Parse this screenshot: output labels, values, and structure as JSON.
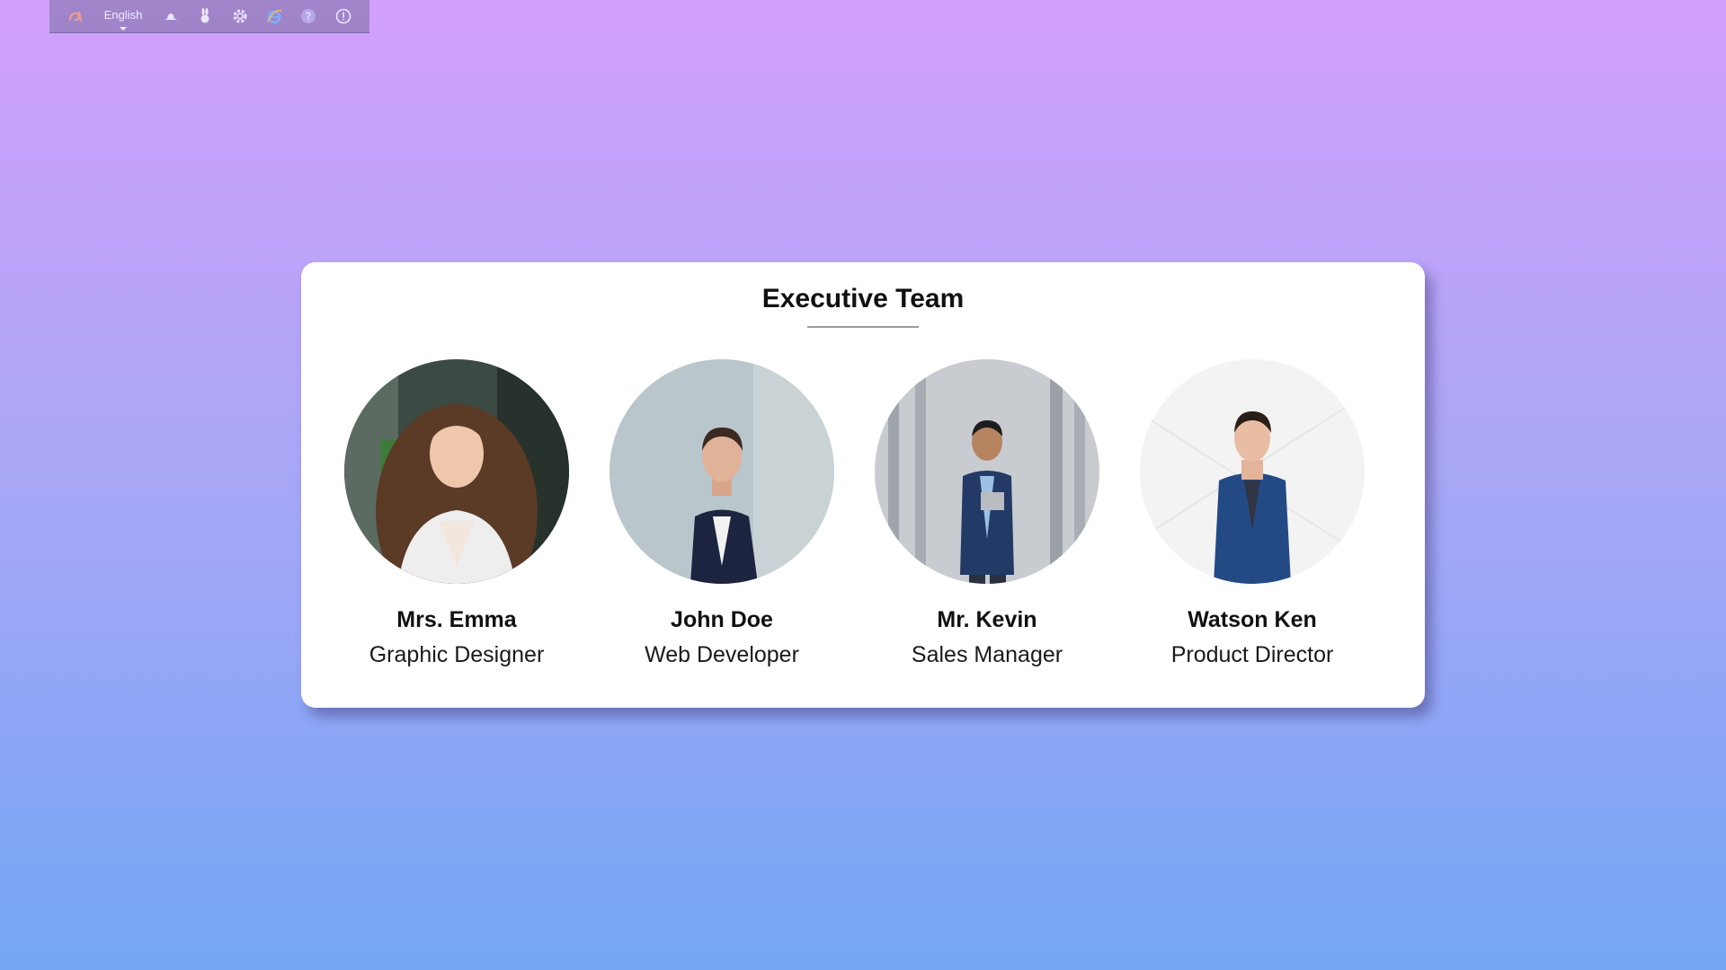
{
  "toolbar": {
    "language": "English",
    "icons": [
      "logo-icon",
      "hat-icon",
      "bunny-icon",
      "gear-icon",
      "browser-icon",
      "help-icon",
      "info-icon"
    ]
  },
  "card": {
    "title": "Executive Team",
    "members": [
      {
        "name": "Mrs. Emma",
        "role": "Graphic Designer"
      },
      {
        "name": "John Doe",
        "role": "Web Developer"
      },
      {
        "name": "Mr. Kevin",
        "role": "Sales Manager"
      },
      {
        "name": "Watson Ken",
        "role": "Product Director"
      }
    ]
  },
  "colors": {
    "bg_top": "#d3a0fd",
    "bg_bottom": "#74a6f6",
    "card": "#ffffff",
    "text": "#111111"
  }
}
